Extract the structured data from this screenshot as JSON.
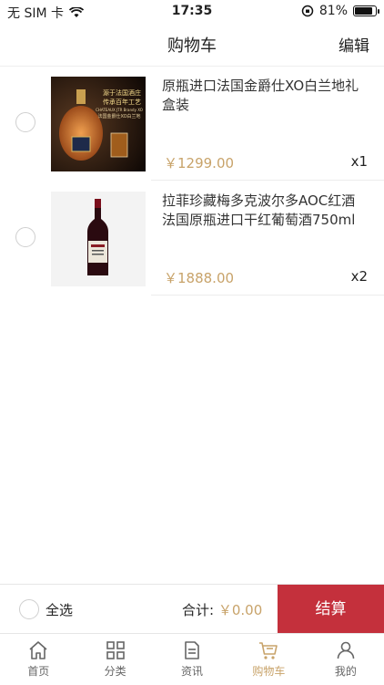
{
  "status_bar": {
    "carrier": "无 SIM 卡",
    "time": "17:35",
    "battery": "81%"
  },
  "nav": {
    "title": "购物车",
    "edit_label": "编辑"
  },
  "cart_items": [
    {
      "name": "原瓶进口法国金爵仕XO白兰地礼盒装",
      "price": "￥1299.00",
      "qty": "x1"
    },
    {
      "name": "拉菲珍藏梅多克波尔多AOC红酒法国原瓶进口干红葡萄酒750ml",
      "price": "￥1888.00",
      "qty": "x2"
    }
  ],
  "image_text": {
    "line1": "源于法国酒庄",
    "line2": "传承百年工艺",
    "line3": "CHATEAUX JTR Brandy XO",
    "line4": "法国金爵仕XO白兰地"
  },
  "checkout": {
    "select_all": "全选",
    "total_label": "合计:",
    "total_value": "￥0.00",
    "button": "结算"
  },
  "tabs": [
    {
      "label": "首页",
      "icon": "home-icon"
    },
    {
      "label": "分类",
      "icon": "grid-icon"
    },
    {
      "label": "资讯",
      "icon": "document-icon"
    },
    {
      "label": "购物车",
      "icon": "cart-icon"
    },
    {
      "label": "我的",
      "icon": "user-icon"
    }
  ],
  "colors": {
    "accent": "#c8a36a",
    "checkout": "#c4303c"
  }
}
